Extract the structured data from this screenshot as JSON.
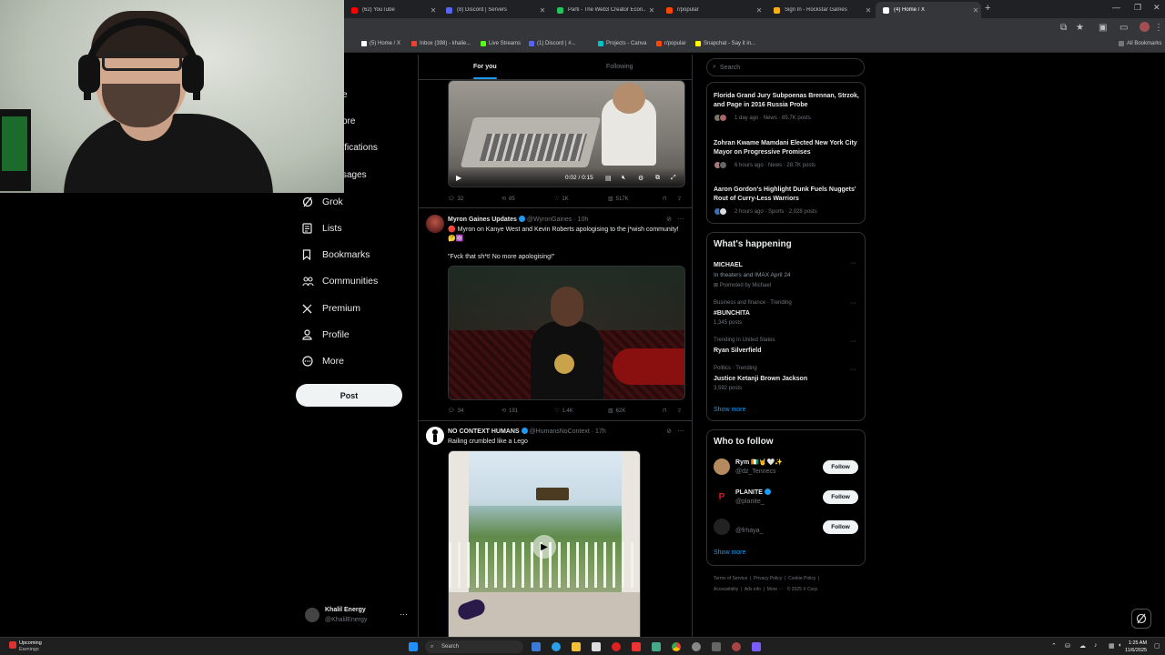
{
  "browser": {
    "tabs": [
      {
        "label": "(62) YouTube",
        "color": "#ff0000"
      },
      {
        "label": "(8) Discord | Servers",
        "color": "#5865f2"
      },
      {
        "label": "Parti - The Web3 Creator Econ...",
        "color": "#23c45e"
      },
      {
        "label": "r/popular",
        "color": "#ff4500"
      },
      {
        "label": "Sign In - Rockstar Games",
        "color": "#fcaf17"
      },
      {
        "label": "(4) Home / X",
        "color": "#ffffff"
      }
    ],
    "bookmarks": [
      {
        "label": "(5) Home / X",
        "color": "#ffffff"
      },
      {
        "label": "Inbox (398) - khalie...",
        "color": "#ea4335"
      },
      {
        "label": "Live Streams",
        "color": "#53fc18"
      },
      {
        "label": "(1) Discord | #...",
        "color": "#5865f2"
      },
      {
        "label": "Projects - Canva",
        "color": "#00c4cc"
      },
      {
        "label": "r/popular",
        "color": "#ff4500"
      },
      {
        "label": "Snapchat - Say it in...",
        "color": "#fffc00"
      }
    ],
    "all_bookmarks": "All Bookmarks"
  },
  "nav": {
    "partial": [
      "e",
      "ore",
      "ifications",
      "sages"
    ],
    "items": [
      {
        "label": "Grok",
        "icon": "grok-icon"
      },
      {
        "label": "Lists",
        "icon": "lists-icon"
      },
      {
        "label": "Bookmarks",
        "icon": "bookmark-icon"
      },
      {
        "label": "Communities",
        "icon": "communities-icon"
      },
      {
        "label": "Premium",
        "icon": "x-logo-icon"
      },
      {
        "label": "Profile",
        "icon": "profile-icon"
      },
      {
        "label": "More",
        "icon": "more-circle-icon"
      }
    ],
    "post_label": "Post"
  },
  "account": {
    "name": "Khalil Energy",
    "handle": "@KhalilEnergy"
  },
  "feed": {
    "tabs": {
      "for_you": "For you",
      "following": "Following"
    },
    "video1": {
      "time": "0:02 / 0:15",
      "actions": {
        "replies": "32",
        "reposts": "85",
        "likes": "1K",
        "views": "517K"
      }
    },
    "tweet2": {
      "name": "Myron Gaines Updates",
      "handle": "@WyronGaines",
      "time": "10h",
      "text1": "🔴 Myron on Kanye West and Kevin Roberts apologising to the j*wish community!🤔🔯",
      "text2": "\"Fvck that sh*t! No more apologising!\"",
      "actions": {
        "replies": "34",
        "reposts": "191",
        "likes": "1.4K",
        "views": "62K"
      }
    },
    "tweet3": {
      "name": "NO CONTEXT HUMANS",
      "handle": "@HumansNoContext",
      "time": "17h",
      "text": "Railing crumbled like a Lego"
    }
  },
  "right": {
    "search_placeholder": "Search",
    "news": [
      {
        "title": "Florida Grand Jury Subpoenas Brennan, Strzok, and Page in 2016 Russia Probe",
        "meta": "1 day ago · News · 85.7K posts"
      },
      {
        "title": "Zohran Kwame Mamdani Elected New York City Mayor on Progressive Promises",
        "meta": "6 hours ago · News · 28.7K posts"
      },
      {
        "title": "Aaron Gordon's Highlight Dunk Fuels Nuggets' Rout of Curry-Less Warriors",
        "meta": "2 hours ago · Sports · 2,028 posts"
      }
    ],
    "happening_title": "What's happening",
    "trends": [
      {
        "small": "",
        "big": "MICHAEL",
        "sub": "In theaters and IMAX April 24",
        "promo": "Promoted by Michael"
      },
      {
        "small": "Business and finance · Trending",
        "big": "#BUNCHITA",
        "sub": "1,345 posts"
      },
      {
        "small": "Trending in United States",
        "big": "Ryan Silverfield",
        "sub": ""
      },
      {
        "small": "Politics · Trending",
        "big": "Justice Ketanji Brown Jackson",
        "sub": "3,592 posts"
      }
    ],
    "show_more": "Show more",
    "wtf_title": "Who to follow",
    "wtf": [
      {
        "name": "Rym 🇨🇮🤘🤍✨",
        "handle": "@dz_Tennecs",
        "avatar_color": "#b48a5e"
      },
      {
        "name": "PLANITE",
        "handle": "@planite_",
        "avatar_color": "#d01c24"
      },
      {
        "name": "",
        "handle": "@frhaya_",
        "avatar_color": "#222222"
      }
    ],
    "follow_label": "Follow",
    "footer1": [
      "Terms of Service",
      "Privacy Policy",
      "Cookie Policy"
    ],
    "footer2": [
      "Accessibility",
      "Ads info",
      "More ···",
      "© 2025 X Corp."
    ]
  },
  "taskbar": {
    "weather_title": "Upcoming",
    "weather_sub": "Earnings",
    "search_label": "Search",
    "time": "1:25 AM",
    "date": "11/6/2025"
  }
}
